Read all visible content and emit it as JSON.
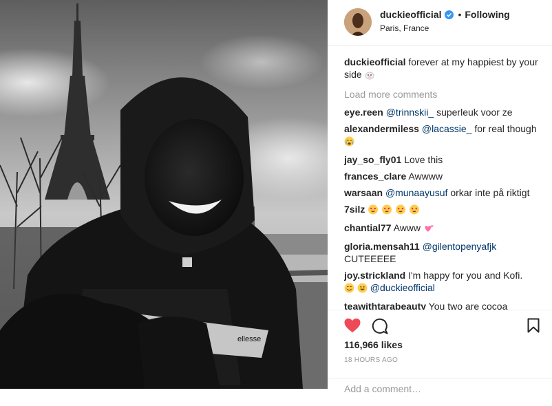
{
  "post": {
    "username": "duckieofficial",
    "status": "Following",
    "location": "Paris, France",
    "caption": "forever at my happiest by your side",
    "load_more": "Load more comments",
    "likes": "116,966 likes",
    "timestamp": "18 HOURS AGO",
    "add_comment_placeholder": "Add a comment…",
    "accent_color": "#3897f0",
    "heart_color": "#ed4956"
  },
  "comments": [
    {
      "user": "eye.reen",
      "mention": "@trinnskii_",
      "text": "superleuk voor ze"
    },
    {
      "user": "alexandermiless",
      "mention": "@lacassie_",
      "text": "for real though"
    },
    {
      "user": "jay_so_fly01",
      "text": "Love this"
    },
    {
      "user": "frances_clare",
      "text": "Awwww"
    },
    {
      "user": "warsaan",
      "mention": "@munaayusuf",
      "text": "orkar inte på riktigt"
    },
    {
      "user": "7silz",
      "text": ""
    },
    {
      "user": "chantial77",
      "text": "Awww"
    },
    {
      "user": "gloria.mensah11",
      "mention": "@gilentopenyafjk",
      "text": "CUTEEEEE"
    },
    {
      "user": "joy.strickland",
      "text": "I'm happy for you and Kofi.",
      "mention": "@duckieofficial"
    },
    {
      "user": "teawithtarabeauty",
      "text": "You two are cocoa perfection! So adorable!"
    }
  ],
  "photo": {
    "jacket_brand": "ellesse"
  }
}
